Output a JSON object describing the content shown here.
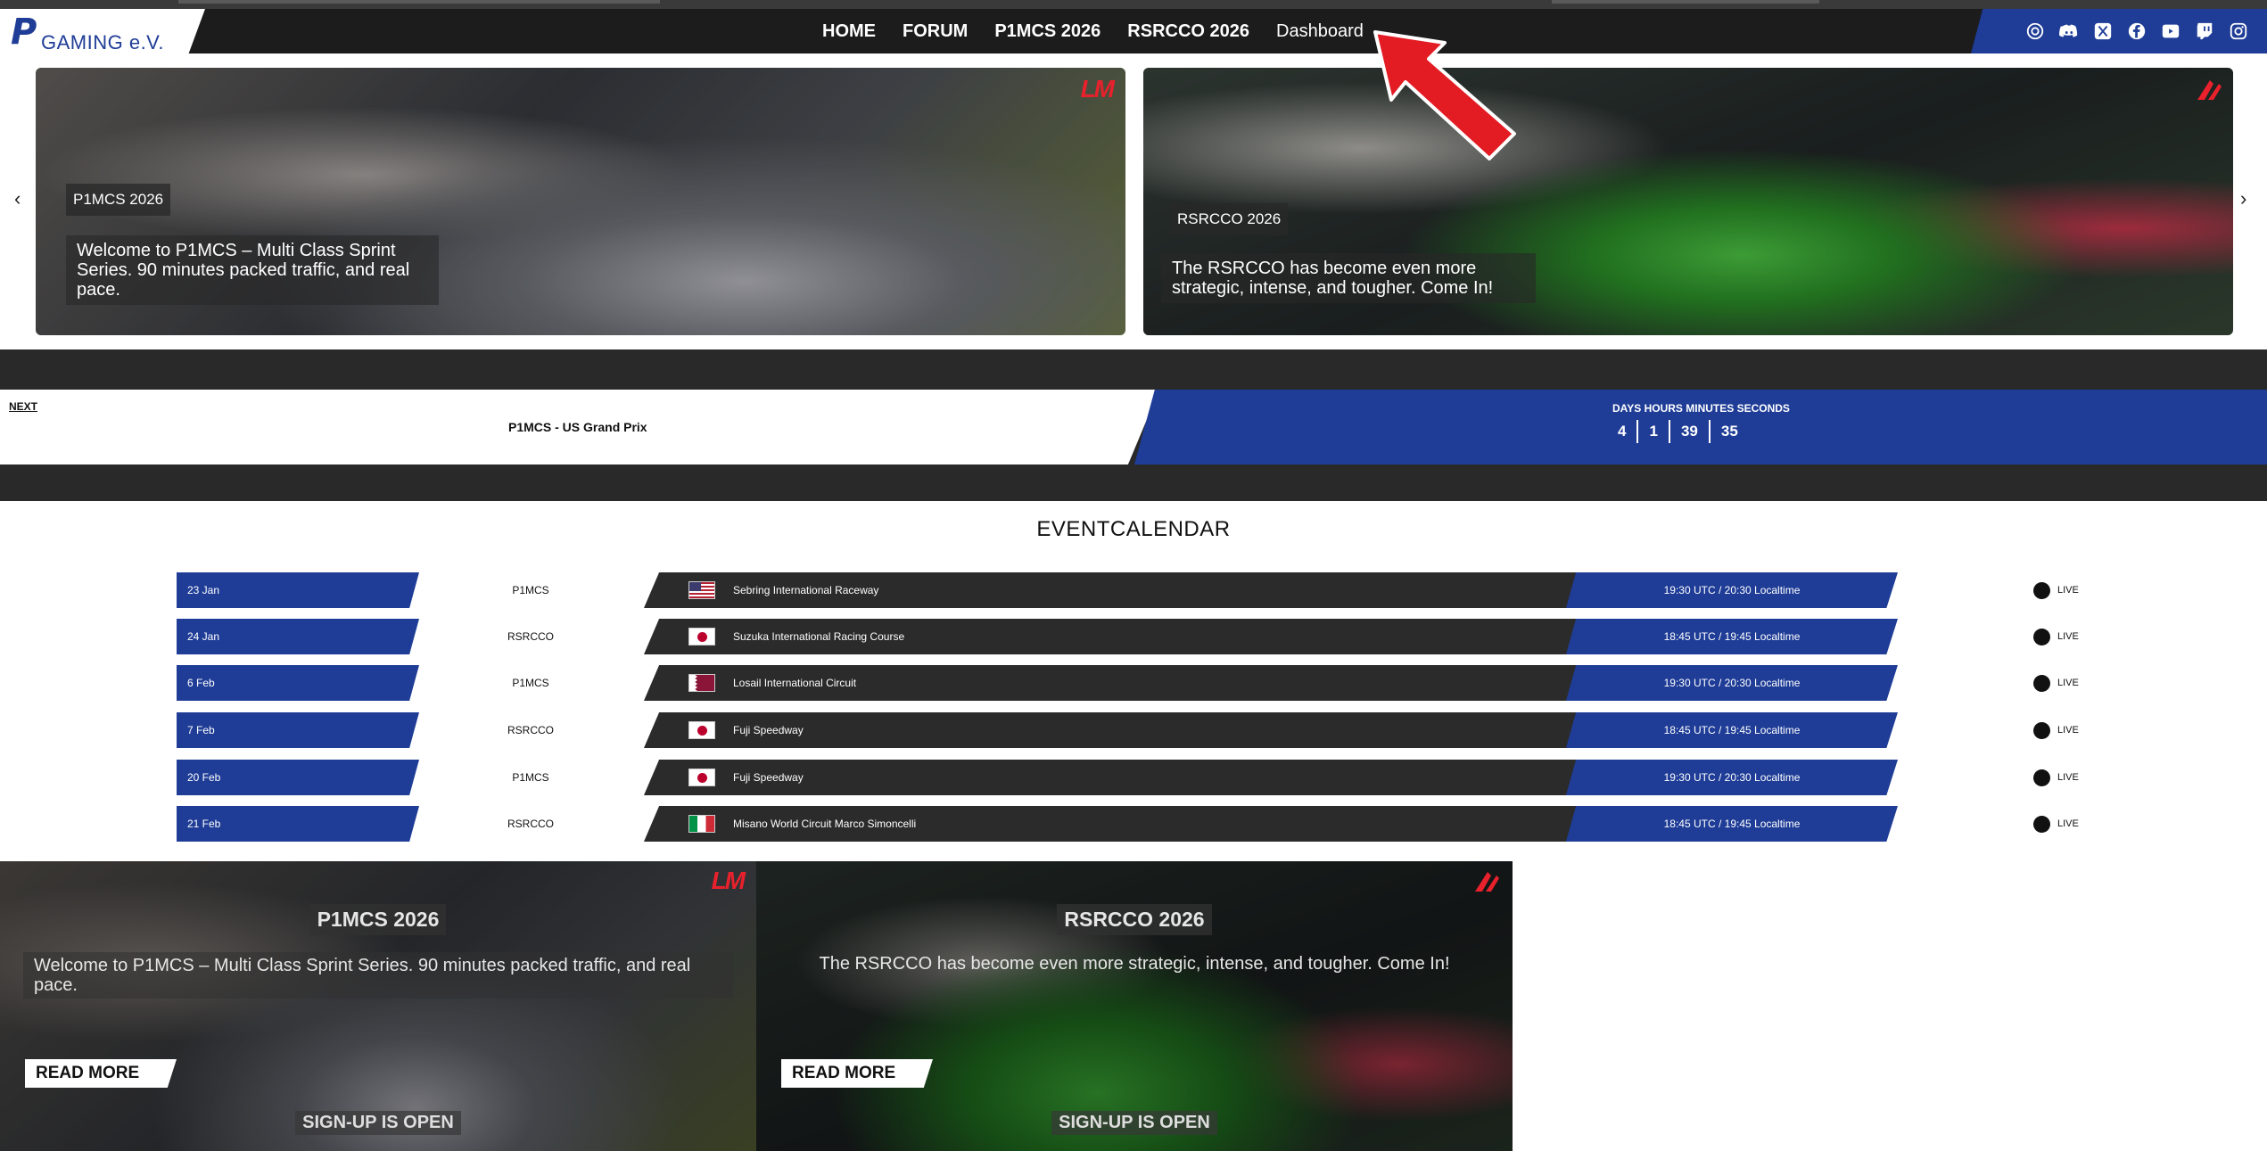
{
  "brand": {
    "logo_letter": "P",
    "logo_text": "GAMING e.V."
  },
  "nav": {
    "items": [
      {
        "label": "HOME"
      },
      {
        "label": "FORUM"
      },
      {
        "label": "P1MCS 2026"
      },
      {
        "label": "RSRCCO 2026"
      },
      {
        "label": "Dashboard"
      }
    ],
    "social_icons": [
      "community-icon",
      "discord-icon",
      "x-icon",
      "facebook-icon",
      "youtube-icon",
      "twitch-icon",
      "instagram-icon"
    ]
  },
  "slider": {
    "slides": [
      {
        "tag": "P1MCS 2026",
        "description": "Welcome to P1MCS – Multi Class Sprint Series. 90 minutes packed traffic, and real pace.",
        "brand_mark": "LM"
      },
      {
        "tag": "RSRCCO 2026",
        "description": "The RSRCCO has become even more strategic, intense, and tougher. Come In!",
        "brand_mark": "assetto-corsa-icon"
      }
    ],
    "prev_arrow": "‹",
    "next_arrow": "›"
  },
  "next_event": {
    "label": "NEXT",
    "title": "P1MCS - US Grand Prix",
    "countdown_label": "DAYS HOURS MINUTES SECONDS",
    "days": "4",
    "hours": "1",
    "minutes": "39",
    "seconds": "35"
  },
  "calendar": {
    "title": "EVENTCALENDAR",
    "rows": [
      {
        "date": "23 Jan",
        "series": "P1MCS",
        "flag": "us",
        "track": "Sebring International Raceway",
        "time": "19:30 UTC / 20:30 Localtime",
        "live": "LIVE"
      },
      {
        "date": "24 Jan",
        "series": "RSRCCO",
        "flag": "jp",
        "track": "Suzuka International Racing Course",
        "time": "18:45 UTC / 19:45 Localtime",
        "live": "LIVE"
      },
      {
        "date": "6 Feb",
        "series": "P1MCS",
        "flag": "qa",
        "track": "Losail International Circuit",
        "time": "19:30 UTC / 20:30 Localtime",
        "live": "LIVE"
      },
      {
        "date": "7 Feb",
        "series": "RSRCCO",
        "flag": "jp",
        "track": "Fuji Speedway",
        "time": "18:45 UTC / 19:45 Localtime",
        "live": "LIVE"
      },
      {
        "date": "20 Feb",
        "series": "P1MCS",
        "flag": "jp",
        "track": "Fuji Speedway",
        "time": "19:30 UTC / 20:30 Localtime",
        "live": "LIVE"
      },
      {
        "date": "21 Feb",
        "series": "RSRCCO",
        "flag": "it",
        "track": "Misano World Circuit Marco Simoncelli",
        "time": "18:45 UTC / 19:45 Localtime",
        "live": "LIVE"
      }
    ]
  },
  "cards": [
    {
      "title": "P1MCS 2026",
      "description": "Welcome to P1MCS – Multi Class Sprint Series. 90 minutes packed traffic, and real pace.",
      "read_more": "READ MORE",
      "signup": "SIGN-UP IS OPEN",
      "brand_mark": "LM"
    },
    {
      "title": "RSRCCO 2026",
      "description": "The RSRCCO has become even more strategic, intense, and tougher. Come In!",
      "read_more": "READ MORE",
      "signup": "SIGN-UP IS OPEN",
      "brand_mark": "assetto-corsa-icon"
    }
  ],
  "colors": {
    "brand_blue": "#1f3d97",
    "dark": "#1c1c1c",
    "row_dark": "#2b2b2b",
    "accent_red": "#e8212c"
  }
}
